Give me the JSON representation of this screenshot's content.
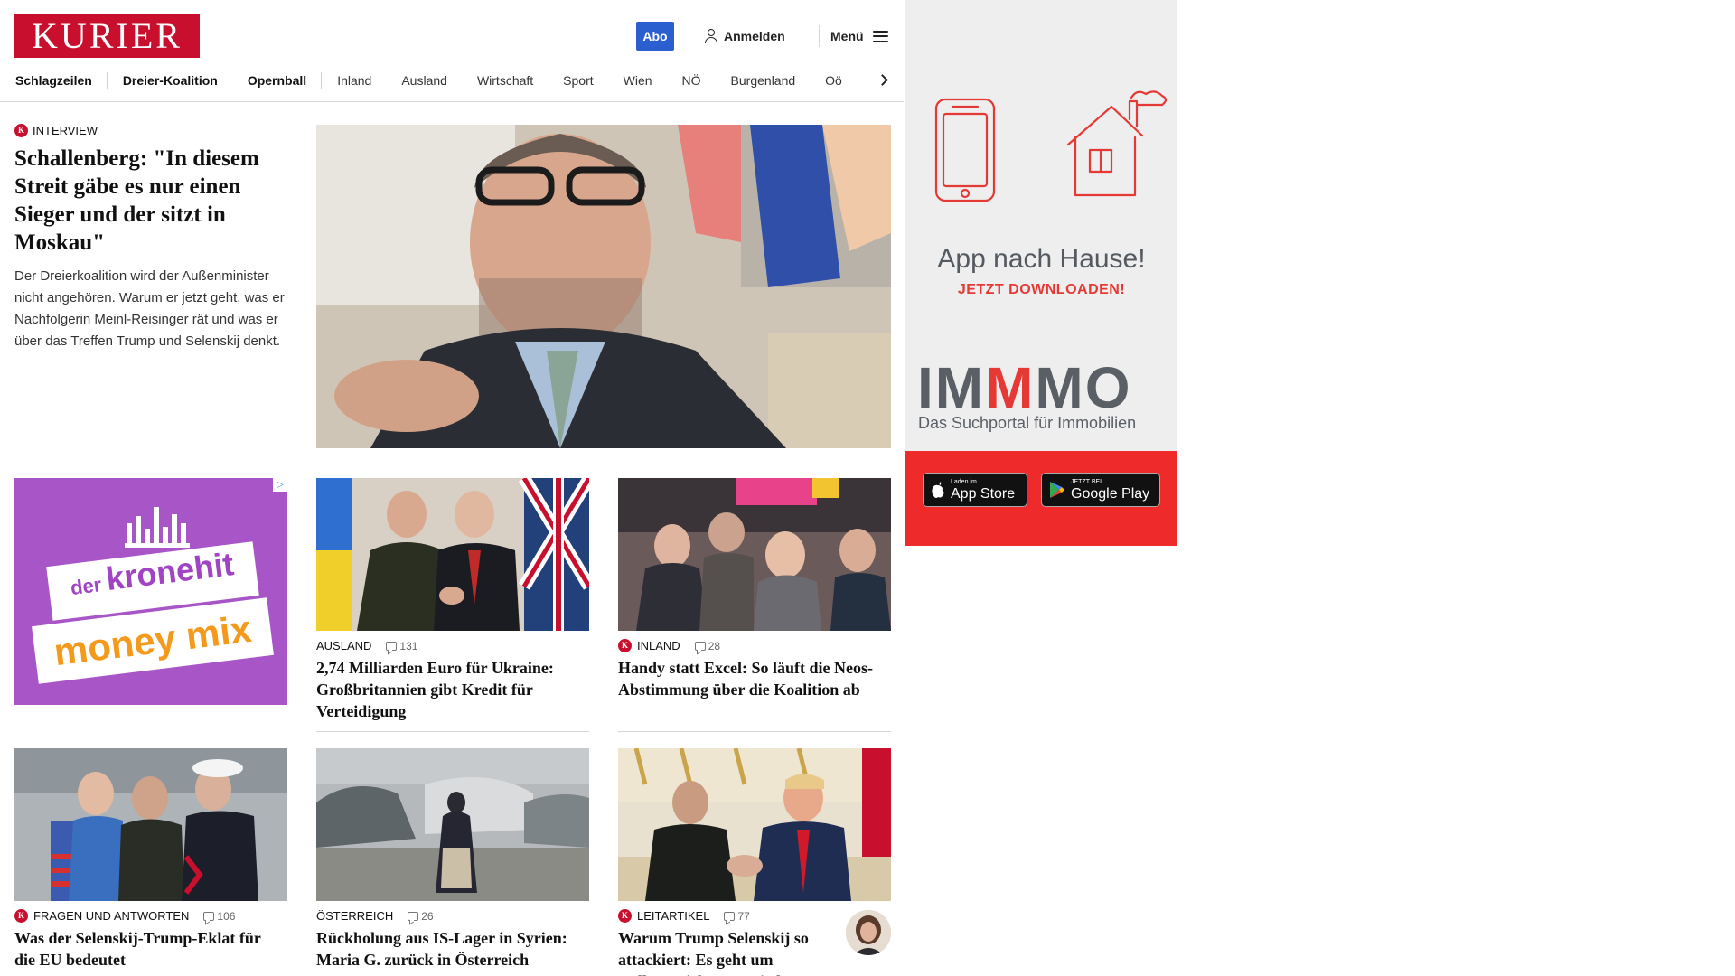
{
  "header": {
    "logo_text": "KURIER",
    "abo_label": "Abo",
    "login_label": "Anmelden",
    "menu_label": "Menü"
  },
  "nav": {
    "items": [
      "Schlagzeilen",
      "Dreier-Koalition",
      "Opernball",
      "Inland",
      "Ausland",
      "Wirtschaft",
      "Sport",
      "Wien",
      "NÖ",
      "Burgenland",
      "Oö"
    ]
  },
  "lead": {
    "kicker": "INTERVIEW",
    "title": "Schallenberg: \"In diesem Streit gäbe es nur einen Sieger und der sitzt in Moskau\"",
    "teaser": "Der Dreierkoalition wird der Außenminister nicht angehören. Warum er jetzt geht, was er Nachfolgerin Meinl-Reisinger rät und was er über das Treffen Trump und Selenskij denkt."
  },
  "ad": {
    "der": "der",
    "kronehit": "kronehit",
    "moneymix": "money mix",
    "choices_icon": "ad-choices-icon"
  },
  "articles": [
    {
      "category": "AUSLAND",
      "k_badge": false,
      "comments": "131",
      "title": "2,74 Milliarden Euro für Ukraine: Großbritannien gibt Kredit für Verteidigung"
    },
    {
      "category": "INLAND",
      "k_badge": true,
      "comments": "28",
      "title": "Handy statt Excel: So läuft die Neos-Abstimmung über die Koalition ab"
    },
    {
      "category": "FRAGEN UND ANTWORTEN",
      "k_badge": true,
      "comments": "106",
      "title": "Was der Selenskij-Trump-Eklat für die EU bedeutet"
    },
    {
      "category": "ÖSTERREICH",
      "k_badge": false,
      "comments": "26",
      "title": "Rückholung aus IS-Lager in Syrien: Maria G. zurück in Österreich"
    },
    {
      "category": "LEITARTIKEL",
      "k_badge": true,
      "comments": "77",
      "title": "Warum Trump Selenskij so attackiert: Es geht um Dollars, nicht um Frieden"
    }
  ],
  "sidebar_ad": {
    "title": "App nach Hause!",
    "subtitle": "JETZT DOWNLOADEN!",
    "brand_pre": "IM",
    "brand_red": "M",
    "brand_post": "MO",
    "brand_sub": "Das Suchportal für Immobilien",
    "appstore_small": "Laden im",
    "appstore_big": "App Store",
    "googleplay_small": "JETZT BEI",
    "googleplay_big": "Google Play"
  },
  "colors": {
    "brand_red": "#c8102e",
    "abo_blue": "#2b5fd0",
    "ad_purple": "#a855c8",
    "sidebar_red": "#ee2a2a"
  }
}
